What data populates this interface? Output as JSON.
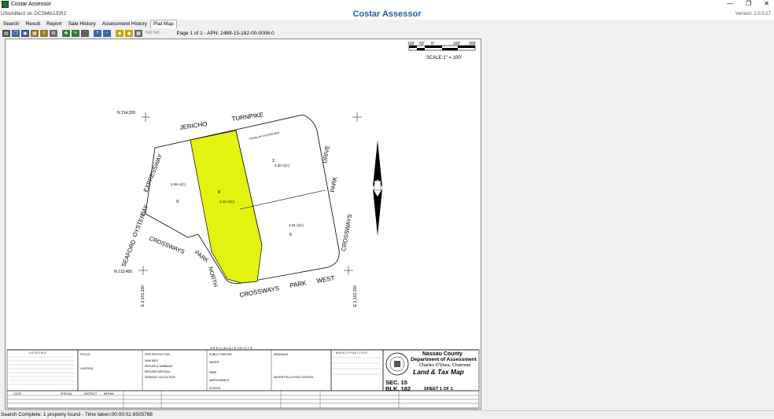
{
  "window": {
    "title": "Costar Assessor",
    "minimize": "—",
    "restore": "❐",
    "close": "✕"
  },
  "header": {
    "user": "USsmiller2 on DCSMILLER2",
    "app_title": "Costar Assessor",
    "version": "Version: 1.0.0.27"
  },
  "tabs": [
    {
      "label": "Search"
    },
    {
      "label": "Result"
    },
    {
      "label": "Report"
    },
    {
      "label": "Sale History"
    },
    {
      "label": "Assessment History"
    },
    {
      "label": "Plat Map"
    }
  ],
  "active_tab": "Plat Map",
  "toolbar": {
    "buttons": [
      {
        "icon": "print-icon",
        "color": "#4a4a4a"
      },
      {
        "icon": "copy-icon",
        "color": "#3b5fa0"
      },
      {
        "icon": "save-icon",
        "color": "#2f4f8f"
      },
      {
        "icon": "image-icon",
        "color": "#8a6d2a"
      },
      {
        "icon": "export-icon",
        "color": "#9a7a30"
      },
      {
        "icon": "settings-icon",
        "color": "#6a6a6a"
      },
      {
        "icon": "pan-icon",
        "color": "#2e7d32"
      },
      {
        "icon": "draw-icon",
        "color": "#2e7d32"
      },
      {
        "icon": "select-icon",
        "color": "#555"
      },
      {
        "icon": "zoom-in-icon",
        "color": "#3a66a8"
      },
      {
        "icon": "zoom-out-icon",
        "color": "#3a66a8"
      },
      {
        "icon": "measure-icon",
        "color": "#c9a400"
      },
      {
        "icon": "rotate-icon",
        "color": "#c9a400"
      },
      {
        "icon": "fit-icon",
        "color": "#666"
      }
    ],
    "percent_text": "%0 %0",
    "page_info": "Page 1 of 1 - APN: 2489-15-182-00-0008-0"
  },
  "map": {
    "scale_ticks": [
      "100'",
      "50'",
      "0'",
      "100'",
      "200'"
    ],
    "scale_label": "SCALE:1\" = 100'",
    "coords": {
      "n_top": "N 214,200",
      "n_bottom": "N 213,450",
      "e_left": "E 2,141,150",
      "e_right": "E 2,142,150"
    },
    "streets": [
      "JERICHO",
      "TURNPIKE",
      "SEAFORD",
      "OYSTER",
      "BAY",
      "EXPRESSWAY",
      "CROSSWAYS",
      "PARK",
      "NORTH",
      "CROSSWAYS",
      "PARK",
      "WEST",
      "CROSSWAYS",
      "PARK",
      "DRIVE"
    ],
    "lots": [
      {
        "num": "9",
        "acres": "2.06 A(C)"
      },
      {
        "num": "8",
        "acres": "2.16 A(C)"
      },
      {
        "num": "2",
        "acres": "3.20 A(C)"
      },
      {
        "num": "6",
        "acres": "3.01 A(C)"
      }
    ],
    "town_label": "TOWN OF OYSTER BAY",
    "legend_header": "L E G E N D",
    "special_districts_header": "S P E C I A L   D I S T R I C T S",
    "municipalities_header": "M U N I C I P A L I T I E S",
    "district_labels": [
      "POLICE",
      "FIRE PROTECTION",
      "PUBLIC PARKING",
      "DRAINAGE",
      "LIGHTING",
      "SANITARY",
      "REFUSE & GARBAGE",
      "WATER",
      "REFUSE DISPOSAL",
      "SEWAGE COLLECTION",
      "PARK",
      "IMPROVEMENT",
      "SCHOOL",
      "WATER POLLUTION CONTROL"
    ],
    "title_block": {
      "county": "Nassau County",
      "department": "Department of Assessment",
      "chairman": "Charles O'Shea, Chairman",
      "map_title": "Land & Tax Map",
      "section": "SEC. 15",
      "block": "BLK. 182",
      "sheet": "SHEET 1 OF 1"
    },
    "table_headers": [
      "CODE",
      "SPECIAL",
      "DISTRICT",
      "WITHIN"
    ],
    "highlight_color": "#e4f20f"
  },
  "status": {
    "text": "Search Complete: 1 property found - Time taken:00:00:02.6505788"
  }
}
